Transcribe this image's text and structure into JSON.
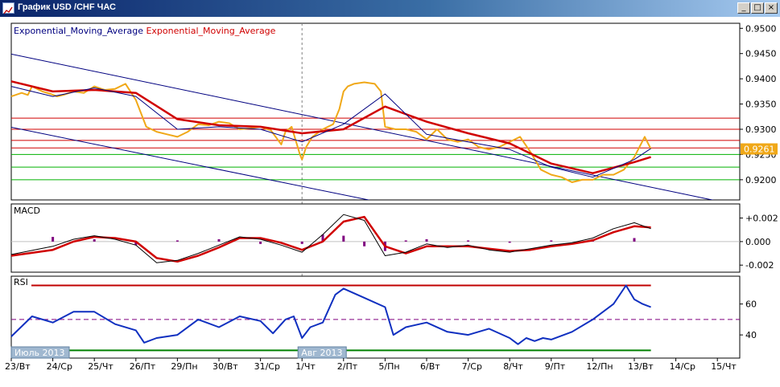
{
  "window": {
    "title": "График USD /CHF ЧАС",
    "buttons": [
      "_",
      "□",
      "×"
    ]
  },
  "legend": {
    "item1": "Exponential_Moving_Average",
    "item2": "Exponential_Moving_Average"
  },
  "colors": {
    "price": "#f0a818",
    "ema_fast": "#000080",
    "ema_slow": "#d00000",
    "trendline": "#000080",
    "hline_red": "#d00000",
    "hline_green": "#00b000",
    "macd_hist": "#800080",
    "rsi": "#1030c0",
    "rsi_top": "#c00000",
    "rsi_bottom": "#008000",
    "rsi_mid": "#800080",
    "price_label_bg": "#f0a818"
  },
  "price_label": "0.9261",
  "period_labels": [
    "Июль 2013",
    "Авг 2013"
  ],
  "chart_data": [
    {
      "type": "line",
      "panel": "price",
      "ylim": [
        0.916,
        0.951
      ],
      "ytick_labels": [
        "0.9500",
        "0.9450",
        "0.9400",
        "0.9350",
        "0.9300",
        "0.9250",
        "0.9200"
      ],
      "ytick_values": [
        0.95,
        0.945,
        0.94,
        0.935,
        0.93,
        0.925,
        0.92
      ],
      "xlim": [
        0,
        1.3
      ],
      "x_tick_labels": [
        "23/Вт",
        "24/Ср",
        "25/Чт",
        "26/Пт",
        "29/Пн",
        "30/Вт",
        "31/Ср",
        "1/Чт",
        "2/Пт",
        "5/Пн",
        "6/Вт",
        "7/Ср",
        "8/Чт",
        "9/Пт",
        "12/Пн",
        "13/Вт",
        "14/Ср",
        "15/Чт"
      ],
      "price_series": {
        "x": [
          0,
          0.1,
          0.25,
          0.4,
          0.5,
          0.75,
          0.95,
          1.1,
          1.25,
          1.5,
          1.75,
          2.0,
          2.25,
          2.5,
          2.75,
          3.0,
          3.25,
          3.5,
          3.75,
          4.0,
          4.25,
          4.5,
          4.75,
          5.0,
          5.25,
          5.5,
          5.75,
          6.0,
          6.25,
          6.5,
          6.6,
          6.75,
          6.95,
          7.0,
          7.1,
          7.25,
          7.5,
          7.75,
          7.9,
          8.0,
          8.1,
          8.25,
          8.5,
          8.75,
          8.9,
          9.0,
          9.25,
          9.5,
          9.75,
          10.0,
          10.25,
          10.5,
          10.75,
          11.0,
          11.25,
          11.5,
          11.75,
          12.0,
          12.25,
          12.5,
          12.75,
          13.0,
          13.25,
          13.5,
          13.75,
          14.0,
          14.25,
          14.5,
          14.75,
          15.0,
          15.25,
          15.4
        ],
        "y": [
          0.9365,
          0.9368,
          0.9372,
          0.9368,
          0.9385,
          0.9375,
          0.937,
          0.9365,
          0.9368,
          0.9375,
          0.9372,
          0.9385,
          0.9378,
          0.938,
          0.939,
          0.9358,
          0.9305,
          0.9295,
          0.929,
          0.9285,
          0.9295,
          0.931,
          0.9308,
          0.9315,
          0.9312,
          0.93,
          0.9302,
          0.9305,
          0.9298,
          0.927,
          0.9295,
          0.9305,
          0.925,
          0.924,
          0.9265,
          0.9285,
          0.93,
          0.931,
          0.934,
          0.9375,
          0.9385,
          0.939,
          0.9393,
          0.939,
          0.9375,
          0.9305,
          0.93,
          0.93,
          0.9295,
          0.928,
          0.93,
          0.928,
          0.9275,
          0.928,
          0.9265,
          0.926,
          0.9265,
          0.9275,
          0.9285,
          0.9255,
          0.922,
          0.921,
          0.9205,
          0.9195,
          0.92,
          0.92,
          0.921,
          0.921,
          0.922,
          0.9245,
          0.9285,
          0.9261
        ]
      },
      "ema_fast": {
        "x": [
          0,
          1,
          2,
          3,
          4,
          5,
          6,
          7,
          8,
          9,
          10,
          11,
          12,
          13,
          14,
          15,
          15.4
        ],
        "y": [
          0.9385,
          0.9365,
          0.9382,
          0.9365,
          0.93,
          0.9305,
          0.93,
          0.9275,
          0.931,
          0.937,
          0.929,
          0.9275,
          0.926,
          0.9225,
          0.9205,
          0.924,
          0.9262
        ]
      },
      "ema_slow": {
        "x": [
          0,
          1,
          2,
          3,
          4,
          5,
          6,
          7,
          8,
          9,
          10,
          11,
          12,
          13,
          14,
          15,
          15.4
        ],
        "y": [
          0.9395,
          0.9375,
          0.9378,
          0.9372,
          0.932,
          0.9308,
          0.9305,
          0.9292,
          0.93,
          0.9345,
          0.9315,
          0.9292,
          0.9272,
          0.9232,
          0.9213,
          0.9235,
          0.9245
        ]
      },
      "hlines_red": [
        0.9322,
        0.93,
        0.9278,
        0.9263
      ],
      "hlines_green": [
        0.925,
        0.9225,
        0.92
      ],
      "trendlines": [
        {
          "x": [
            0,
            17.4
          ],
          "y": [
            0.9449,
            0.9151
          ]
        },
        {
          "x": [
            0,
            8.9
          ],
          "y": [
            0.9304,
            0.9155
          ]
        }
      ]
    },
    {
      "type": "line",
      "panel": "macd",
      "title": "MACD",
      "ylim": [
        -0.0026,
        0.0032
      ],
      "ytick_labels": [
        "+0.002",
        "0.000",
        "-0.002"
      ],
      "ytick_values": [
        0.002,
        0.0,
        -0.002
      ],
      "macd_line": {
        "x": [
          0,
          1,
          1.5,
          2,
          2.5,
          3,
          3.5,
          4,
          4.5,
          5,
          5.5,
          6,
          6.5,
          7,
          7.5,
          8,
          8.5,
          9,
          9.5,
          10,
          10.5,
          11,
          11.5,
          12,
          12.5,
          13,
          13.5,
          14,
          14.5,
          15,
          15.4
        ],
        "y": [
          -0.0011,
          -0.0004,
          0.0002,
          0.0005,
          0.0002,
          -0.0003,
          -0.0018,
          -0.0016,
          -0.001,
          -0.0003,
          0.0004,
          0.0002,
          -0.0003,
          -0.0009,
          0.0006,
          0.0023,
          0.0018,
          -0.0012,
          -0.0009,
          -0.0002,
          -0.0005,
          -0.0003,
          -0.0007,
          -0.0009,
          -0.0006,
          -0.0003,
          -0.0001,
          0.0003,
          0.0011,
          0.0016,
          0.0011
        ]
      },
      "signal_line": {
        "x": [
          0,
          1,
          1.5,
          2,
          2.5,
          3,
          3.5,
          4,
          4.5,
          5,
          5.5,
          6,
          6.5,
          7,
          7.5,
          8,
          8.5,
          9,
          9.5,
          10,
          10.5,
          11,
          11.5,
          12,
          12.5,
          13,
          13.5,
          14,
          14.5,
          15,
          15.4
        ],
        "y": [
          -0.0012,
          -0.0007,
          0.0,
          0.0004,
          0.0003,
          0.0,
          -0.0014,
          -0.0017,
          -0.0012,
          -0.0005,
          0.0003,
          0.0003,
          -0.0001,
          -0.0007,
          0.0,
          0.0017,
          0.0021,
          -0.0004,
          -0.001,
          -0.0004,
          -0.0004,
          -0.0004,
          -0.0006,
          -0.0008,
          -0.0007,
          -0.0004,
          -0.0002,
          0.0001,
          0.0008,
          0.0013,
          0.0012
        ]
      },
      "histogram": {
        "x": [
          1.0,
          2.0,
          3.0,
          4.0,
          5.0,
          6.0,
          7.0,
          7.5,
          8.0,
          8.5,
          9.0,
          9.5,
          10.0,
          11.0,
          12.0,
          13.0,
          14.0,
          15.0
        ],
        "y": [
          0.0004,
          0.0002,
          -0.0003,
          0.0001,
          0.0002,
          -0.0002,
          -0.0002,
          0.0006,
          0.0005,
          -0.0004,
          -0.0008,
          0.0001,
          0.0002,
          0.0001,
          -0.0001,
          0.0001,
          0.0002,
          0.0003
        ]
      }
    },
    {
      "type": "line",
      "panel": "rsi",
      "title": "RSI",
      "ylim": [
        25,
        78
      ],
      "ytick_labels": [
        "60",
        "40"
      ],
      "ytick_values": [
        60,
        40
      ],
      "levels": {
        "top": 72,
        "mid": 50,
        "bottom": 30
      },
      "rsi": {
        "x": [
          0,
          0.5,
          1,
          1.5,
          2,
          2.5,
          3,
          3.2,
          3.5,
          4,
          4.5,
          5,
          5.5,
          6,
          6.3,
          6.6,
          6.8,
          7,
          7.2,
          7.5,
          7.8,
          8,
          8.5,
          9,
          9.2,
          9.5,
          10,
          10.5,
          11,
          11.5,
          12,
          12.2,
          12.4,
          12.6,
          12.8,
          13,
          13.5,
          14,
          14.5,
          14.8,
          15,
          15.2,
          15.4
        ],
        "y": [
          39,
          52,
          48,
          55,
          55,
          47,
          43,
          35,
          38,
          40,
          50,
          45,
          52,
          49,
          41,
          50,
          52,
          38,
          45,
          48,
          66,
          70,
          64,
          58,
          40,
          45,
          48,
          42,
          40,
          44,
          38,
          34,
          38,
          36,
          38,
          37,
          42,
          50,
          60,
          72,
          63,
          60,
          58
        ]
      }
    }
  ]
}
